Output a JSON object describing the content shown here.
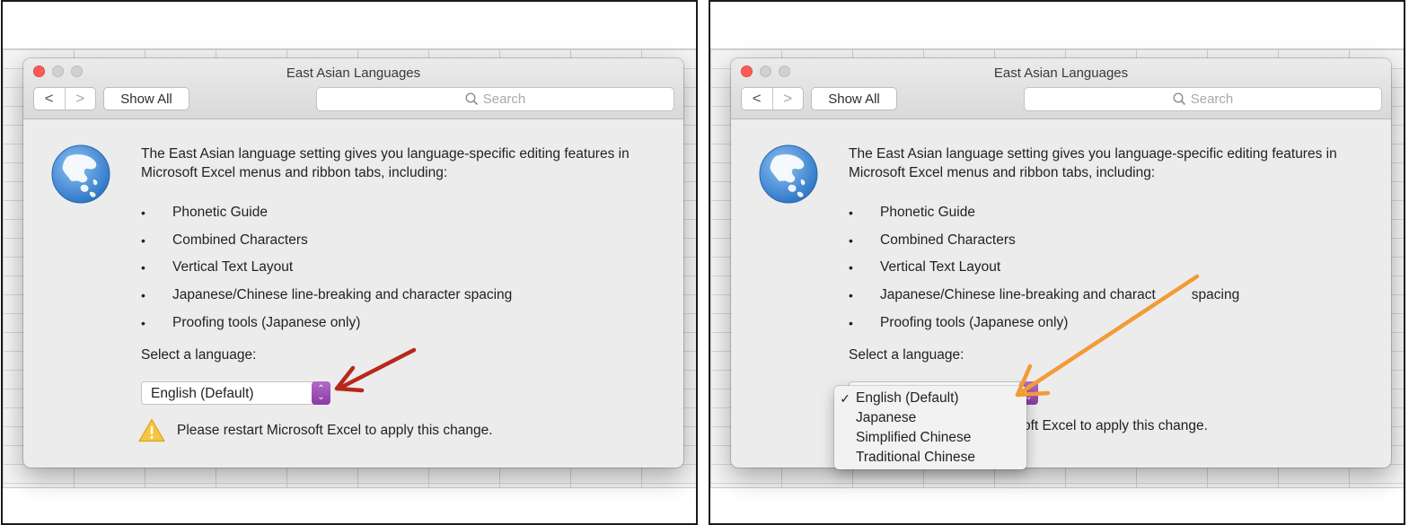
{
  "colors": {
    "red_arrow": "#b7281c",
    "orange_arrow": "#f29b36",
    "stepper": "#9b48b8",
    "close_light": "#fc5b57"
  },
  "panels": [
    {
      "window_title": "East Asian Languages",
      "nav": {
        "back": "<",
        "forward": ">"
      },
      "show_all": "Show All",
      "search_placeholder": "Search",
      "intro": "The East Asian language setting gives you language-specific editing features in Microsoft Excel menus and ribbon tabs, including:",
      "bullet_marker": "•",
      "features": [
        "Phonetic Guide",
        "Combined Characters",
        "Vertical Text Layout",
        "Japanese/Chinese line-breaking and character spacing",
        "Proofing tools (Japanese only)"
      ],
      "select_label": "Select a language:",
      "selected_language": "English (Default)",
      "warning": "Please restart Microsoft Excel to apply this change.",
      "icons": [
        "globe-icon",
        "warning-icon",
        "red-arrow"
      ]
    },
    {
      "window_title": "East Asian Languages",
      "nav": {
        "back": "<",
        "forward": ">"
      },
      "show_all": "Show All",
      "search_placeholder": "Search",
      "intro": "The East Asian language setting gives you language-specific editing features in Microsoft Excel menus and ribbon tabs, including:",
      "bullet_marker": "•",
      "features": [
        "Phonetic Guide",
        "Combined Characters",
        "Vertical Text Layout",
        "Japanese/Chinese line-breaking and charact",
        "Proofing tools (Japanese only)"
      ],
      "feature_tail": "spacing",
      "select_label": "Select a language:",
      "warning_partial": "oft Excel to apply this change.",
      "dropdown": {
        "check_mark": "✓",
        "options": [
          "English (Default)",
          "Japanese",
          "Simplified Chinese",
          "Traditional Chinese"
        ],
        "selected_index": 0
      },
      "icons": [
        "globe-icon",
        "orange-arrow"
      ]
    }
  ]
}
